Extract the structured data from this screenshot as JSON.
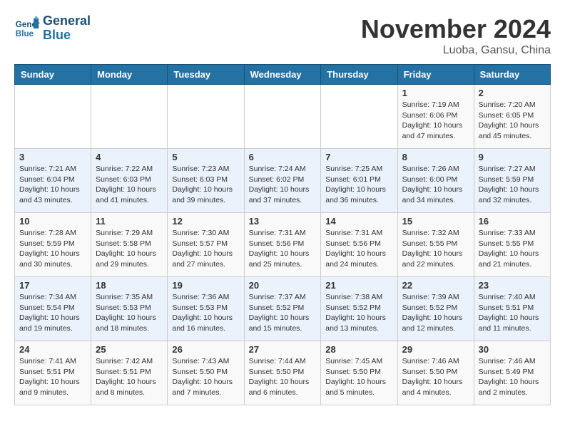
{
  "header": {
    "logo_line1": "General",
    "logo_line2": "Blue",
    "month": "November 2024",
    "location": "Luoba, Gansu, China"
  },
  "weekdays": [
    "Sunday",
    "Monday",
    "Tuesday",
    "Wednesday",
    "Thursday",
    "Friday",
    "Saturday"
  ],
  "weeks": [
    [
      {
        "day": "",
        "info": ""
      },
      {
        "day": "",
        "info": ""
      },
      {
        "day": "",
        "info": ""
      },
      {
        "day": "",
        "info": ""
      },
      {
        "day": "",
        "info": ""
      },
      {
        "day": "1",
        "info": "Sunrise: 7:19 AM\nSunset: 6:06 PM\nDaylight: 10 hours\nand 47 minutes."
      },
      {
        "day": "2",
        "info": "Sunrise: 7:20 AM\nSunset: 6:05 PM\nDaylight: 10 hours\nand 45 minutes."
      }
    ],
    [
      {
        "day": "3",
        "info": "Sunrise: 7:21 AM\nSunset: 6:04 PM\nDaylight: 10 hours\nand 43 minutes."
      },
      {
        "day": "4",
        "info": "Sunrise: 7:22 AM\nSunset: 6:03 PM\nDaylight: 10 hours\nand 41 minutes."
      },
      {
        "day": "5",
        "info": "Sunrise: 7:23 AM\nSunset: 6:03 PM\nDaylight: 10 hours\nand 39 minutes."
      },
      {
        "day": "6",
        "info": "Sunrise: 7:24 AM\nSunset: 6:02 PM\nDaylight: 10 hours\nand 37 minutes."
      },
      {
        "day": "7",
        "info": "Sunrise: 7:25 AM\nSunset: 6:01 PM\nDaylight: 10 hours\nand 36 minutes."
      },
      {
        "day": "8",
        "info": "Sunrise: 7:26 AM\nSunset: 6:00 PM\nDaylight: 10 hours\nand 34 minutes."
      },
      {
        "day": "9",
        "info": "Sunrise: 7:27 AM\nSunset: 5:59 PM\nDaylight: 10 hours\nand 32 minutes."
      }
    ],
    [
      {
        "day": "10",
        "info": "Sunrise: 7:28 AM\nSunset: 5:59 PM\nDaylight: 10 hours\nand 30 minutes."
      },
      {
        "day": "11",
        "info": "Sunrise: 7:29 AM\nSunset: 5:58 PM\nDaylight: 10 hours\nand 29 minutes."
      },
      {
        "day": "12",
        "info": "Sunrise: 7:30 AM\nSunset: 5:57 PM\nDaylight: 10 hours\nand 27 minutes."
      },
      {
        "day": "13",
        "info": "Sunrise: 7:31 AM\nSunset: 5:56 PM\nDaylight: 10 hours\nand 25 minutes."
      },
      {
        "day": "14",
        "info": "Sunrise: 7:31 AM\nSunset: 5:56 PM\nDaylight: 10 hours\nand 24 minutes."
      },
      {
        "day": "15",
        "info": "Sunrise: 7:32 AM\nSunset: 5:55 PM\nDaylight: 10 hours\nand 22 minutes."
      },
      {
        "day": "16",
        "info": "Sunrise: 7:33 AM\nSunset: 5:55 PM\nDaylight: 10 hours\nand 21 minutes."
      }
    ],
    [
      {
        "day": "17",
        "info": "Sunrise: 7:34 AM\nSunset: 5:54 PM\nDaylight: 10 hours\nand 19 minutes."
      },
      {
        "day": "18",
        "info": "Sunrise: 7:35 AM\nSunset: 5:53 PM\nDaylight: 10 hours\nand 18 minutes."
      },
      {
        "day": "19",
        "info": "Sunrise: 7:36 AM\nSunset: 5:53 PM\nDaylight: 10 hours\nand 16 minutes."
      },
      {
        "day": "20",
        "info": "Sunrise: 7:37 AM\nSunset: 5:52 PM\nDaylight: 10 hours\nand 15 minutes."
      },
      {
        "day": "21",
        "info": "Sunrise: 7:38 AM\nSunset: 5:52 PM\nDaylight: 10 hours\nand 13 minutes."
      },
      {
        "day": "22",
        "info": "Sunrise: 7:39 AM\nSunset: 5:52 PM\nDaylight: 10 hours\nand 12 minutes."
      },
      {
        "day": "23",
        "info": "Sunrise: 7:40 AM\nSunset: 5:51 PM\nDaylight: 10 hours\nand 11 minutes."
      }
    ],
    [
      {
        "day": "24",
        "info": "Sunrise: 7:41 AM\nSunset: 5:51 PM\nDaylight: 10 hours\nand 9 minutes."
      },
      {
        "day": "25",
        "info": "Sunrise: 7:42 AM\nSunset: 5:51 PM\nDaylight: 10 hours\nand 8 minutes."
      },
      {
        "day": "26",
        "info": "Sunrise: 7:43 AM\nSunset: 5:50 PM\nDaylight: 10 hours\nand 7 minutes."
      },
      {
        "day": "27",
        "info": "Sunrise: 7:44 AM\nSunset: 5:50 PM\nDaylight: 10 hours\nand 6 minutes."
      },
      {
        "day": "28",
        "info": "Sunrise: 7:45 AM\nSunset: 5:50 PM\nDaylight: 10 hours\nand 5 minutes."
      },
      {
        "day": "29",
        "info": "Sunrise: 7:46 AM\nSunset: 5:50 PM\nDaylight: 10 hours\nand 4 minutes."
      },
      {
        "day": "30",
        "info": "Sunrise: 7:46 AM\nSunset: 5:49 PM\nDaylight: 10 hours\nand 2 minutes."
      }
    ]
  ]
}
